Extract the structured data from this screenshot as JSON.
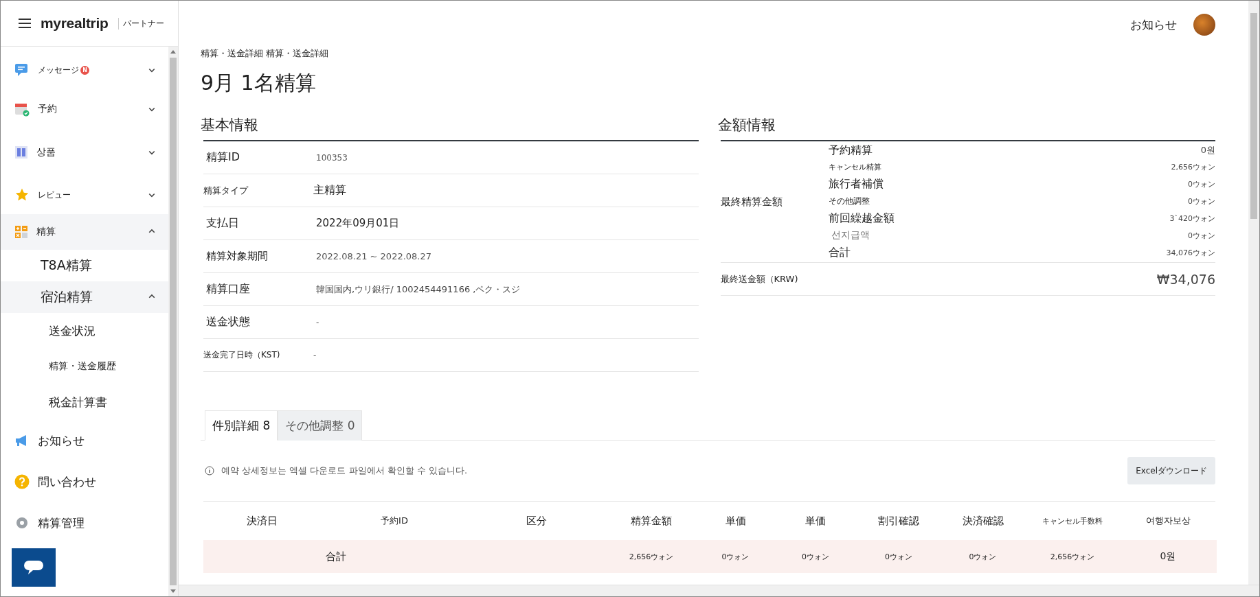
{
  "header": {
    "logo": "myrealtrip",
    "menu_label": "パートナー",
    "notice": "お知らせ"
  },
  "sidebar": {
    "items": [
      {
        "label": "メッセージ",
        "badge": "N",
        "expanded": false
      },
      {
        "label": "予約",
        "expanded": false
      },
      {
        "label": "상품",
        "expanded": false
      },
      {
        "label": "レビュー",
        "expanded": false
      },
      {
        "label": "精算",
        "expanded": true,
        "children": [
          {
            "label": "T8A精算"
          },
          {
            "label": "宿泊精算",
            "expanded": true,
            "children": [
              {
                "label": "送金状況"
              },
              {
                "label": "精算・送金履歴"
              },
              {
                "label": "税金計算書"
              }
            ]
          }
        ]
      },
      {
        "label": "お知らせ"
      },
      {
        "label": "問い合わせ"
      },
      {
        "label": "精算管理"
      }
    ]
  },
  "breadcrumb": "精算・送金詳細 精算・送金詳細",
  "title": "9月 1名精算",
  "basic_info": {
    "heading": "基本情報",
    "rows": [
      {
        "label": "精算ID",
        "value": "100353"
      },
      {
        "label": "精算タイプ",
        "value": "主精算"
      },
      {
        "label": "支払日",
        "value": "2022年09月01日"
      },
      {
        "label": "精算対象期間",
        "value": "2022.08.21 ~ 2022.08.27"
      },
      {
        "label": "精算口座",
        "value": "韓国国内,ウリ銀行/ 1002454491166 ,ペク・スジ"
      },
      {
        "label": "送金状態",
        "value": "-"
      },
      {
        "label": "送金完了日時（KST)",
        "value": "-"
      }
    ]
  },
  "amount_info": {
    "heading": "金額情報",
    "group_label": "最終精算金額",
    "items": [
      {
        "label": "予約精算",
        "value": "0원"
      },
      {
        "label": "キャンセル精算",
        "value": "2,656ウォン"
      },
      {
        "label": "旅行者補償",
        "value": "0ウォン"
      },
      {
        "label": "その他調整",
        "value": "0ウォン"
      },
      {
        "label": "前回繰越金額",
        "value": "3`420ウォン"
      },
      {
        "label": "선지급액",
        "value": "0ウォン"
      },
      {
        "label": "合計",
        "value": "34,076ウォン"
      }
    ],
    "final_label": "最終送金額（KRW)",
    "final_value": "₩34,076"
  },
  "tabs": [
    {
      "label": "件別詳細 8",
      "selected": true
    },
    {
      "label": "その他調整 0",
      "selected": false
    }
  ],
  "notice": "예약 상세정보는 엑셀 다운로드 파일에서 확인할 수 있습니다.",
  "excel_button": "Excelダウンロード",
  "table": {
    "columns": [
      "決済日",
      "予約ID",
      "区分",
      "精算金額",
      "単価",
      "単価",
      "割引確認",
      "決済確認",
      "キャンセル手数料",
      "여행자보상"
    ],
    "total_row": {
      "label": "合計",
      "cells": [
        "2,656ウォン",
        "0ウォン",
        "0ウォン",
        "0ウォン",
        "0ウォン",
        "2,656ウォン",
        "0원"
      ]
    }
  }
}
